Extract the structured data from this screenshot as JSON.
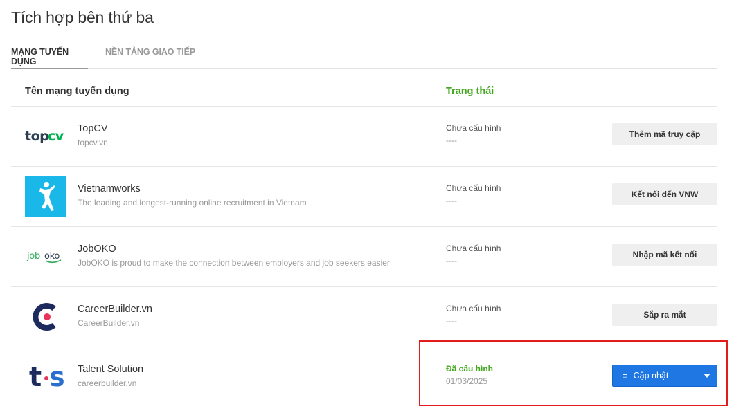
{
  "page": {
    "title": "Tích hợp bên thứ ba"
  },
  "tabs": [
    {
      "label": "MẠNG TUYỂN DỤNG",
      "active": true
    },
    {
      "label": "NỀN TẢNG GIAO TIẾP",
      "active": false
    }
  ],
  "table": {
    "headers": {
      "name": "Tên mạng tuyển dụng",
      "status": "Trạng thái"
    },
    "rows": [
      {
        "logo_text": "topcv",
        "name": "TopCV",
        "description": "topcv.vn",
        "status": "Chưa cấu hình",
        "status_sub": "----",
        "action": "Thêm mã truy cập"
      },
      {
        "logo_icon": "vietnamworks-figure-icon",
        "name": "Vietnamworks",
        "description": "The leading and longest-running online recruitment in Vietnam",
        "status": "Chưa cấu hình",
        "status_sub": "----",
        "action": "Kết nối đến VNW"
      },
      {
        "logo_text": "joboko",
        "name": "JobOKO",
        "description": "JobOKO is proud to make the connection between employers and job seekers easier",
        "status": "Chưa cấu hình",
        "status_sub": "----",
        "action": "Nhập mã kết nối"
      },
      {
        "logo_icon": "careerbuilder-c-icon",
        "name": "CareerBuilder.vn",
        "description": "CareerBuilder.vn",
        "status": "Chưa cấu hình",
        "status_sub": "----",
        "action": "Sắp ra mắt"
      },
      {
        "logo_text": "t·s",
        "name": "Talent Solution",
        "description": "careerbuilder.vn",
        "status": "Đã cấu hình",
        "status_sub": "01/03/2025",
        "action": "Cập nhật",
        "action_icon": "menu-lines-icon",
        "dropdown_icon": "caret-down-icon"
      }
    ]
  },
  "colors": {
    "accent_green": "#43a81f",
    "primary_blue": "#1e77e2",
    "highlight_red": "#e21b1b",
    "vnw_blue": "#1ab8e8",
    "cb_navy": "#1c2a5e",
    "cb_pink": "#e8335a"
  }
}
